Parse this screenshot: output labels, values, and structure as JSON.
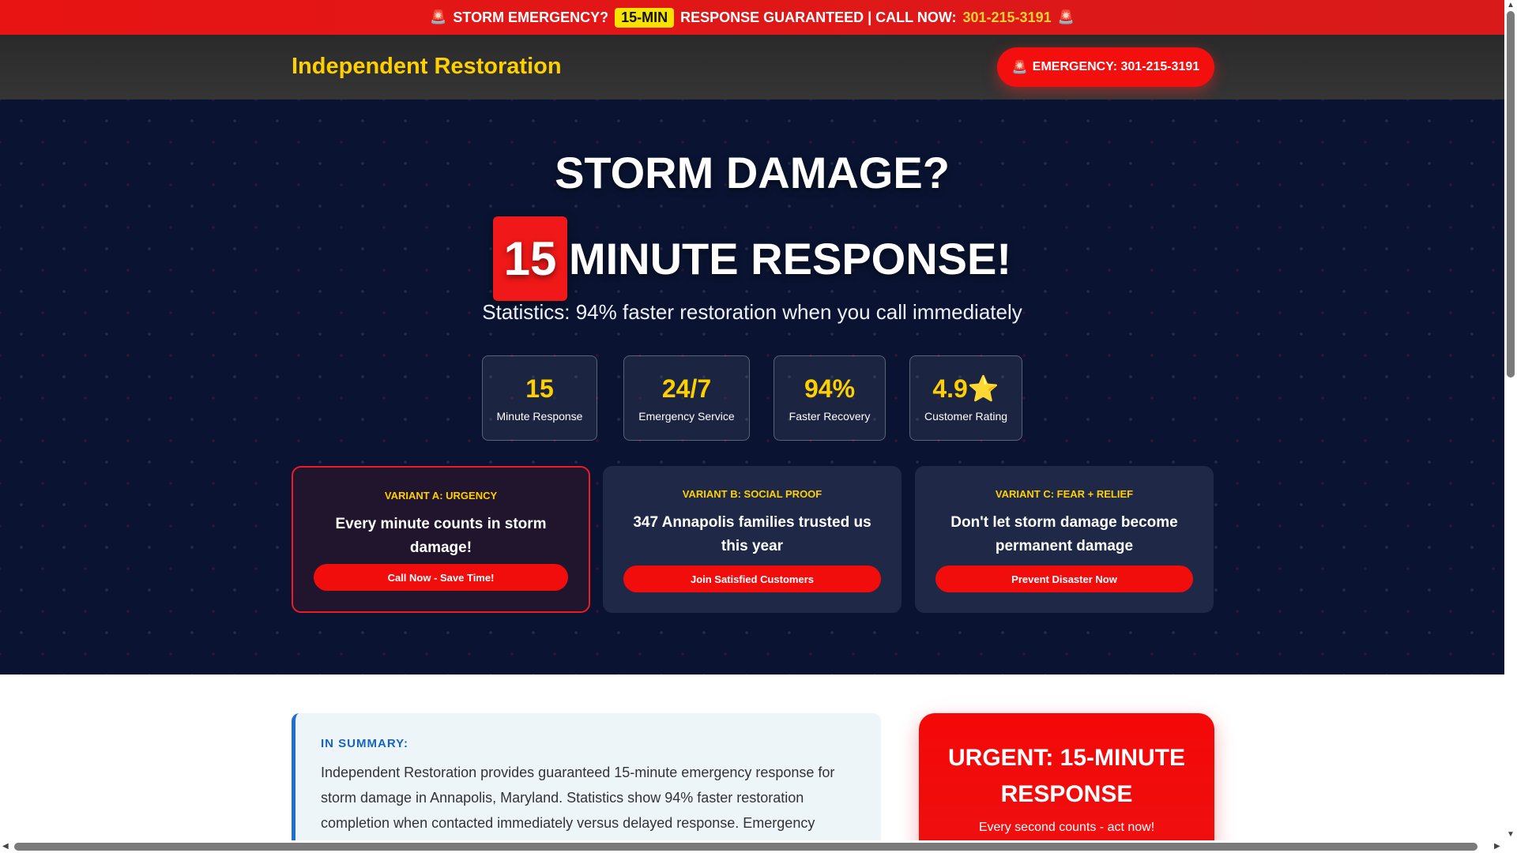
{
  "top_banner": {
    "siren_icon": "🚨",
    "text_before": "STORM EMERGENCY?",
    "highlight": "15-MIN",
    "text_after": "RESPONSE GUARANTEED | CALL NOW:",
    "phone": "301-215-3191"
  },
  "header": {
    "logo": "Independent Restoration",
    "emergency_button": "EMERGENCY: 301-215-3191",
    "siren_icon": "🚨"
  },
  "hero": {
    "title_line1": "STORM DAMAGE?",
    "title_number": "15",
    "title_line2": "MINUTE RESPONSE!",
    "subtitle": "Statistics: 94% faster restoration when you call immediately",
    "stats": [
      {
        "value": "15",
        "label": "Minute Response"
      },
      {
        "value": "24/7",
        "label": "Emergency Service"
      },
      {
        "value": "94%",
        "label": "Faster Recovery"
      },
      {
        "value": "4.9⭐",
        "label": "Customer Rating"
      }
    ],
    "variants": [
      {
        "tag": "VARIANT A: URGENCY",
        "headline": "Every minute counts in storm damage!",
        "button": "Call Now - Save Time!"
      },
      {
        "tag": "VARIANT B: SOCIAL PROOF",
        "headline": "347 Annapolis families trusted us this year",
        "button": "Join Satisfied Customers"
      },
      {
        "tag": "VARIANT C: FEAR + RELIEF",
        "headline": "Don't let storm damage become permanent damage",
        "button": "Prevent Disaster Now"
      }
    ]
  },
  "summary": {
    "heading": "IN SUMMARY:",
    "text": "Independent Restoration provides guaranteed 15-minute emergency response for storm damage in Annapolis, Maryland. Statistics show 94% faster restoration completion when contacted immediately versus delayed response. Emergency"
  },
  "urgent_box": {
    "title": "URGENT: 15-MINUTE RESPONSE",
    "subtitle": "Every second counts - act now!"
  },
  "scrollbars": {
    "left_arrow": "◀",
    "right_arrow": "▶",
    "up_arrow": "▲",
    "down_arrow": "▼"
  },
  "colors": {
    "brand_red": "#f40f0f",
    "accent_yellow": "#ffd000",
    "hero_bg": "#0a1432",
    "summary_blue": "#1565c0"
  }
}
